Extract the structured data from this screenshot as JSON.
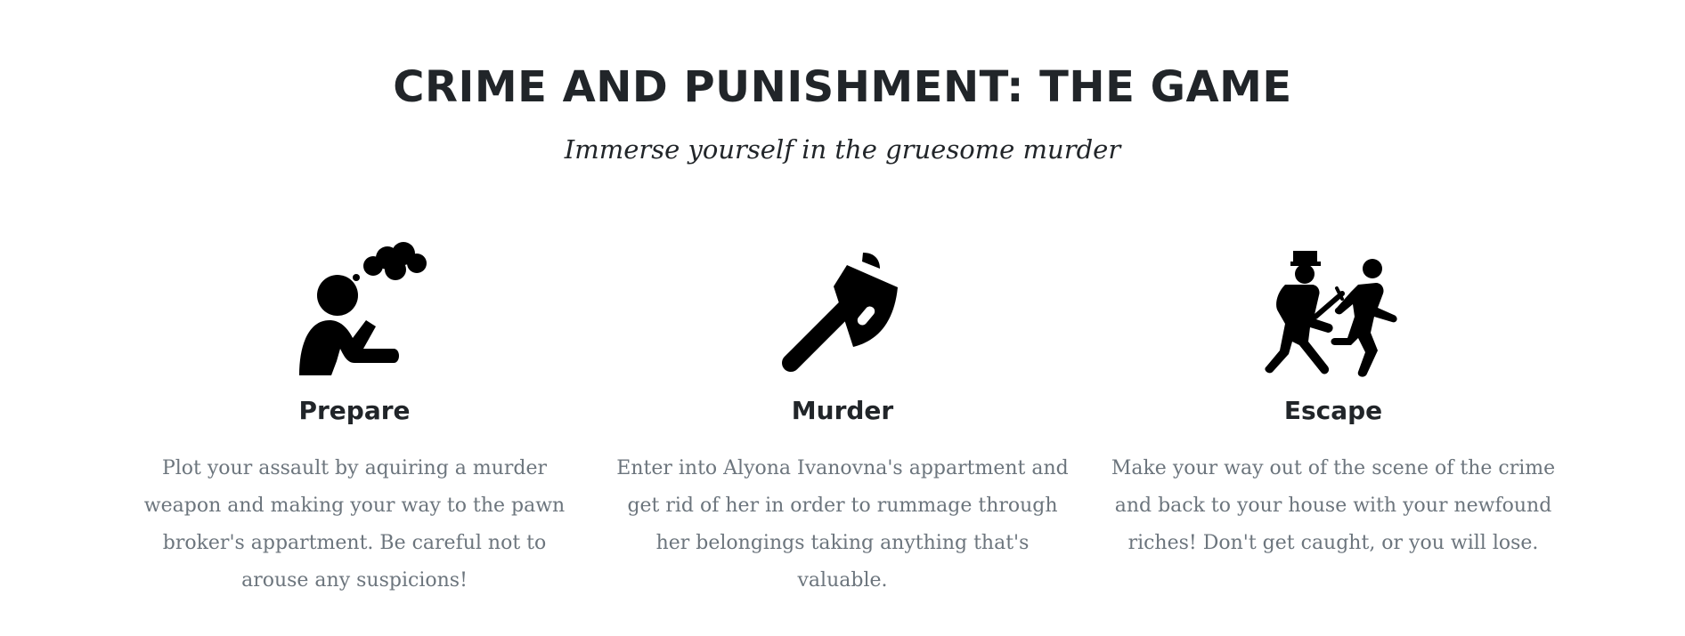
{
  "header": {
    "title": "CRIME AND PUNISHMENT: THE GAME",
    "subtitle": "Immerse yourself in the gruesome murder"
  },
  "features": [
    {
      "icon": "thinking-person-icon",
      "heading": "Prepare",
      "text": "Plot your assault by aquiring a murder weapon and making your way to the pawn broker's appartment. Be careful not to arouse any suspicions!"
    },
    {
      "icon": "axe-icon",
      "heading": "Murder",
      "text": "Enter into Alyona Ivanovna's appartment and get rid of her in order to rummage through her belongings taking anything that's valuable."
    },
    {
      "icon": "police-chase-icon",
      "heading": "Escape",
      "text": "Make your way out of the scene of the crime and back to your house with your newfound riches! Don't get caught, or you will lose."
    }
  ],
  "colors": {
    "heading": "#212529",
    "body_text": "#6c757d",
    "icon": "#000000",
    "background": "#ffffff"
  }
}
